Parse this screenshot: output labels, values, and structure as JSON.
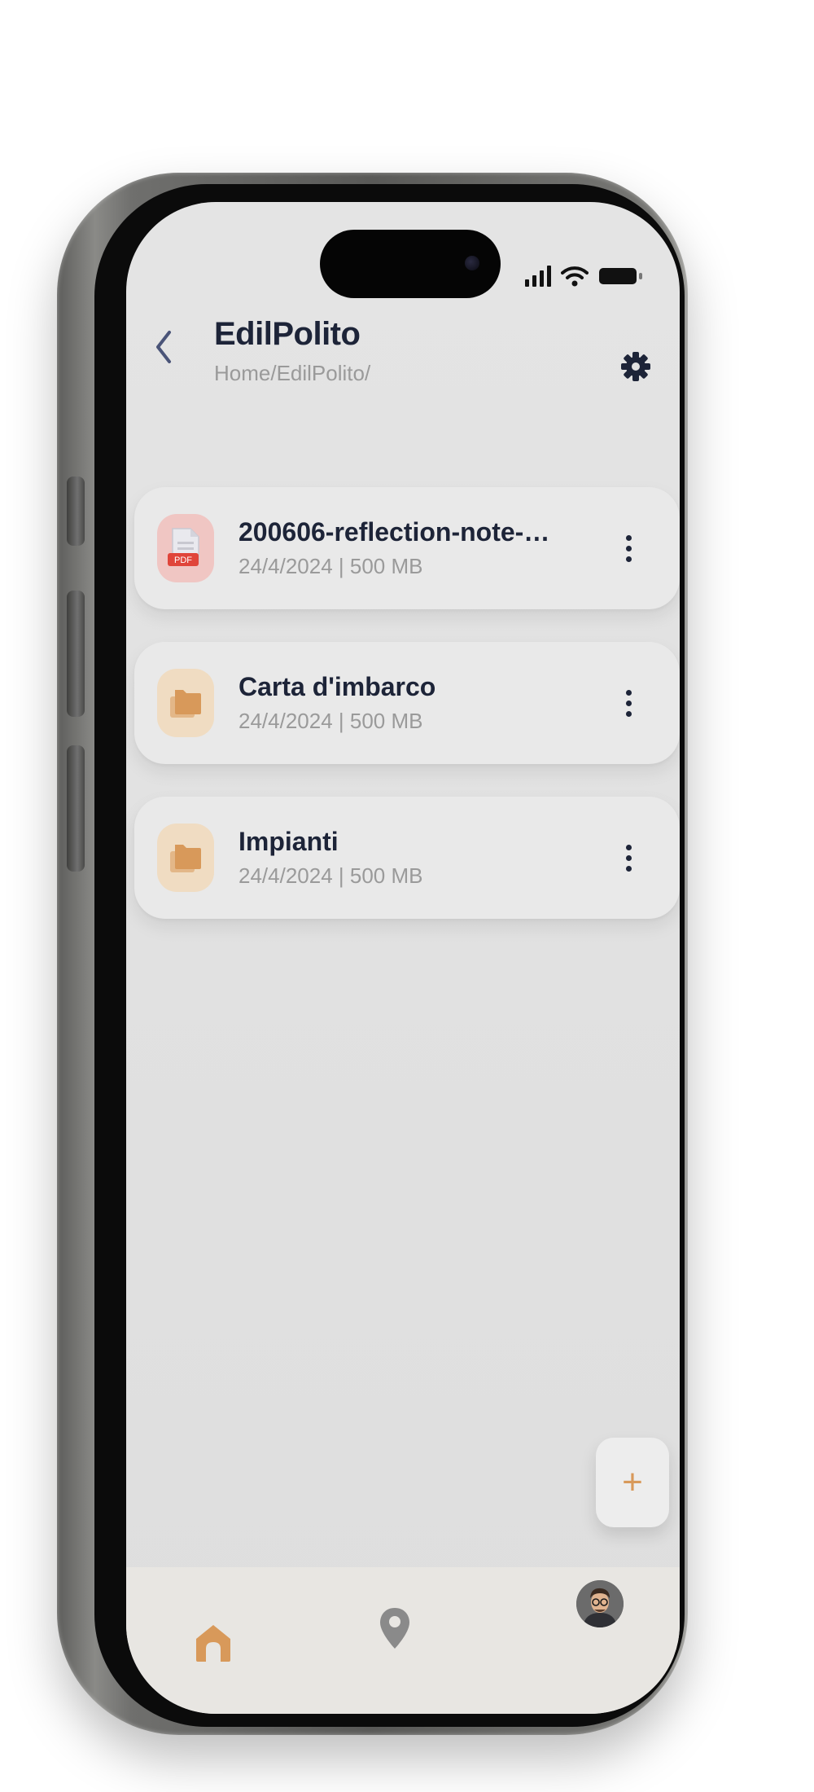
{
  "app": {
    "title": "EdilPolito",
    "breadcrumb": "Home/EdilPolito/"
  },
  "header": {
    "back_icon": "chevron-left-icon",
    "settings_icon": "gear-icon"
  },
  "files": [
    {
      "name": "200606-reflection-note-p…",
      "date": "24/4/2024",
      "size": "500 MB",
      "meta": "24/4/2024 | 500 MB",
      "type": "pdf",
      "badge": "PDF",
      "icon": "pdf-file-icon"
    },
    {
      "name": "Carta d'imbarco",
      "date": "24/4/2024",
      "size": "500 MB",
      "meta": "24/4/2024 | 500 MB",
      "type": "folder",
      "icon": "folder-icon"
    },
    {
      "name": "Impianti",
      "date": "24/4/2024",
      "size": "500 MB",
      "meta": "24/4/2024 | 500 MB",
      "type": "folder",
      "icon": "folder-icon"
    }
  ],
  "fab": {
    "label": "+",
    "icon": "plus-icon"
  },
  "bottom_nav": [
    {
      "id": "home",
      "icon": "home-icon",
      "active": true
    },
    {
      "id": "map",
      "icon": "map-pin-icon",
      "active": false
    },
    {
      "id": "profile",
      "icon": "avatar",
      "active": false
    }
  ],
  "colors": {
    "accent": "#d8995a",
    "title": "#1d2438",
    "muted": "#9a9a9a",
    "pdf_bg": "#f0c6c3",
    "pdf_badge": "#e0453a",
    "folder_bg": "#f0dcc2",
    "screen_bg": "#e2e2e2",
    "nav_bg": "#e8e6e2"
  }
}
